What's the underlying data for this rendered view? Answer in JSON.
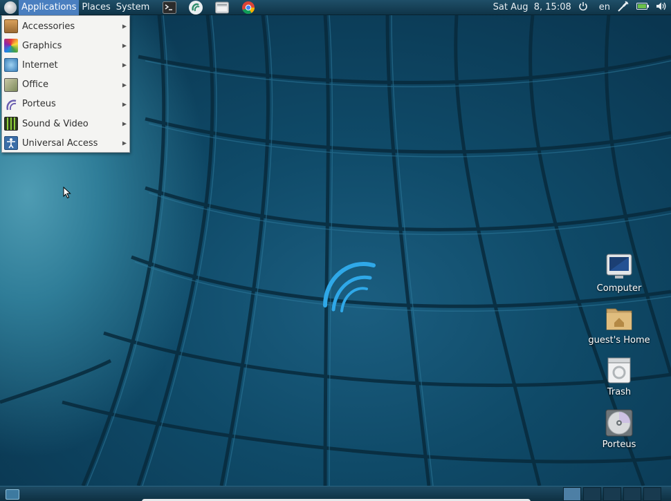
{
  "top_panel": {
    "menus": [
      {
        "label": "Applications",
        "name": "menu-applications"
      },
      {
        "label": "Places",
        "name": "menu-places"
      },
      {
        "label": "System",
        "name": "menu-system"
      }
    ],
    "launchers": [
      "terminal-icon",
      "porteus-launcher-icon",
      "file-manager-icon",
      "chrome-icon"
    ],
    "clock": "Sat Aug  8, 15:08",
    "keyboard_layout": "en"
  },
  "applications_menu": {
    "items": [
      {
        "label": "Accessories",
        "icon": "accessories-icon"
      },
      {
        "label": "Graphics",
        "icon": "graphics-icon"
      },
      {
        "label": "Internet",
        "icon": "internet-icon"
      },
      {
        "label": "Office",
        "icon": "office-icon"
      },
      {
        "label": "Porteus",
        "icon": "porteus-icon"
      },
      {
        "label": "Sound & Video",
        "icon": "sound-video-icon"
      },
      {
        "label": "Universal Access",
        "icon": "universal-access-icon"
      }
    ]
  },
  "desktop_icons": [
    {
      "label": "Computer",
      "icon": "computer-icon"
    },
    {
      "label": "guest's Home",
      "icon": "home-folder-icon"
    },
    {
      "label": "Trash",
      "icon": "trash-icon"
    },
    {
      "label": "Porteus",
      "icon": "disc-icon"
    }
  ],
  "colors": {
    "panel": "#0f3448",
    "menu_highlight": "#4a7fc0",
    "menu_background": "#f4f4f2",
    "wallpaper_dark": "#0a3650",
    "wallpaper_light": "#4f9cb3"
  }
}
